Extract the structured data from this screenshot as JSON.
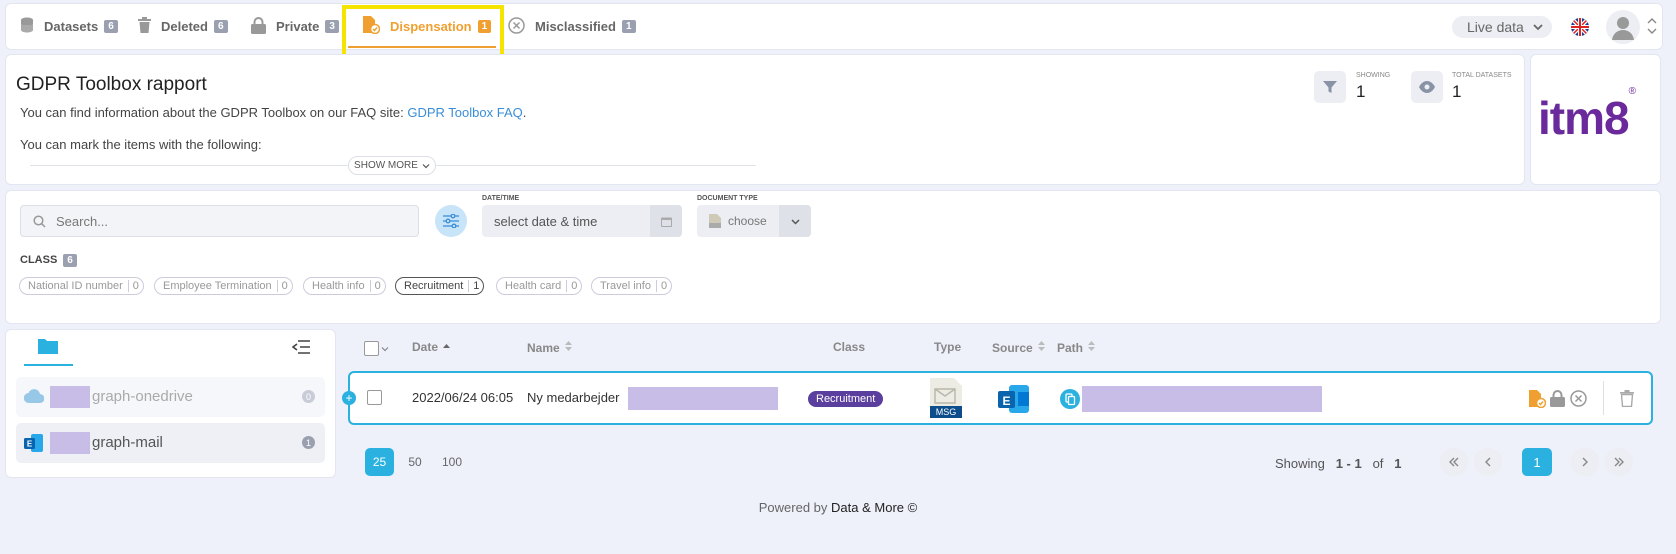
{
  "nav": {
    "tabs": [
      {
        "label": "Datasets",
        "count": "6"
      },
      {
        "label": "Deleted",
        "count": "6"
      },
      {
        "label": "Private",
        "count": "3"
      },
      {
        "label": "Dispensation",
        "count": "1"
      },
      {
        "label": "Misclassified",
        "count": "1"
      }
    ],
    "live_data": "Live data"
  },
  "report": {
    "title": "GDPR Toolbox rapport",
    "info_prefix": "You can find information about the GDPR Toolbox on our FAQ site:",
    "faq_link": "GDPR Toolbox FAQ",
    "info_suffix": ".",
    "mark_text": "You can mark the items with the following:",
    "show_more": "SHOW MORE",
    "showing_label": "SHOWING",
    "showing_value": "1",
    "total_label": "TOTAL DATASETS",
    "total_value": "1"
  },
  "logo": {
    "text": "itm8",
    "mark": "®"
  },
  "filters": {
    "search_placeholder": "Search...",
    "date_label": "DATE/TIME",
    "date_placeholder": "select date & time",
    "doctype_label": "DOCUMENT TYPE",
    "doctype_placeholder": "choose",
    "class_label": "CLASS",
    "class_count": "6",
    "tags": [
      {
        "label": "National ID number",
        "count": "0"
      },
      {
        "label": "Employee Termination",
        "count": "0"
      },
      {
        "label": "Health info",
        "count": "0"
      },
      {
        "label": "Recruitment",
        "count": "1"
      },
      {
        "label": "Health card",
        "count": "0"
      },
      {
        "label": "Travel info",
        "count": "0"
      }
    ]
  },
  "tree": {
    "items": [
      {
        "label": "graph-onedrive",
        "count": "0"
      },
      {
        "label": "graph-mail",
        "count": "1"
      }
    ]
  },
  "table": {
    "headers": {
      "date": "Date",
      "name": "Name",
      "class": "Class",
      "type": "Type",
      "source": "Source",
      "path": "Path"
    },
    "row": {
      "date": "2022/06/24 06:05",
      "name": "Ny medarbejder",
      "class": "Recruitment",
      "type": "MSG",
      "source_letter": "E"
    }
  },
  "pagination": {
    "sizes": [
      "25",
      "50",
      "100"
    ],
    "showing_text": "Showing",
    "range": "1 - 1",
    "of_text": "of",
    "total": "1",
    "current_page": "1"
  },
  "footer": {
    "prefix": "Powered by",
    "brand": "Data & More ©"
  },
  "colors": {
    "accent": "#2ab1e0",
    "dispensation": "#f0a030",
    "recruitment": "#5b3f9e",
    "logo": "#6b2a9b"
  }
}
